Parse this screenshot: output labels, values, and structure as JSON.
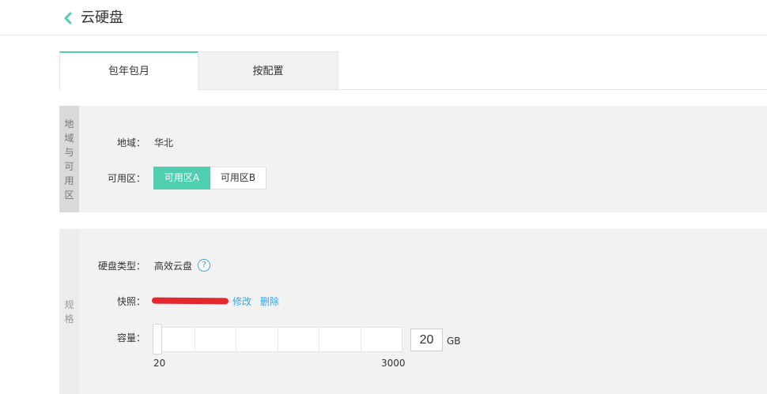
{
  "header": {
    "title": "云硬盘",
    "back_icon": "chevron-left-icon",
    "accent": "#4fcfb0"
  },
  "tabs": [
    {
      "label": "包年包月",
      "active": true
    },
    {
      "label": "按配置",
      "active": false
    }
  ],
  "region_section": {
    "side_label": "地域与可用区",
    "region_label": "地域：",
    "region_value": "华北",
    "zone_label": "可用区：",
    "zones": [
      {
        "label": "可用区A",
        "selected": true
      },
      {
        "label": "可用区B",
        "selected": false
      }
    ]
  },
  "spec_section": {
    "side_label": "规格",
    "disk_type_label": "硬盘类型：",
    "disk_type_value": "高效云盘",
    "help_icon": "?",
    "snapshot_label": "快照：",
    "snapshot_edit": "修改",
    "snapshot_delete": "删除",
    "capacity_label": "容量：",
    "slider_min": "20",
    "slider_max": "3000",
    "capacity_value": "20",
    "capacity_unit": "GB"
  },
  "colors": {
    "link": "#3ba3e0",
    "selected": "#4fcfb0",
    "redaction": "#e5282e"
  }
}
